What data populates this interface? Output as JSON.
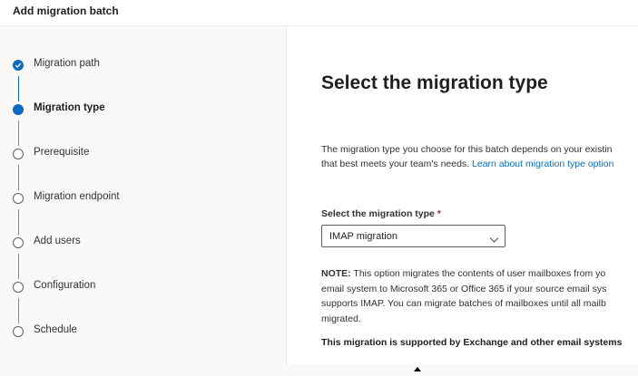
{
  "header": {
    "title": "Add migration batch"
  },
  "steps": [
    {
      "label": "Migration path",
      "state": "completed"
    },
    {
      "label": "Migration type",
      "state": "current"
    },
    {
      "label": "Prerequisite",
      "state": "pending"
    },
    {
      "label": "Migration endpoint",
      "state": "pending"
    },
    {
      "label": "Add users",
      "state": "pending"
    },
    {
      "label": "Configuration",
      "state": "pending"
    },
    {
      "label": "Schedule",
      "state": "pending"
    }
  ],
  "main": {
    "heading": "Select the migration type",
    "description_line1": "The migration type you choose for this batch depends on your existin",
    "description_line2_text": "that best meets your team's needs. ",
    "description_link": "Learn about migration type option",
    "field_label": "Select the migration type",
    "required_mark": "*",
    "selected_value": "IMAP migration",
    "note_label": "NOTE:",
    "note_line1": " This option migrates the contents of user mailboxes from yo",
    "note_line2": "email system to Microsoft 365 or Office 365 if your source email sys",
    "note_line3": "supports IMAP. You can migrate batches of mailboxes until all mailb",
    "note_line4": "migrated.",
    "support_text": "This migration is supported by Exchange and other email systems"
  },
  "colors": {
    "accent": "#0f6cbd",
    "required": "#a4262c"
  },
  "icons": {
    "completed_step": "checkmark-icon",
    "dropdown": "chevron-down-icon"
  }
}
